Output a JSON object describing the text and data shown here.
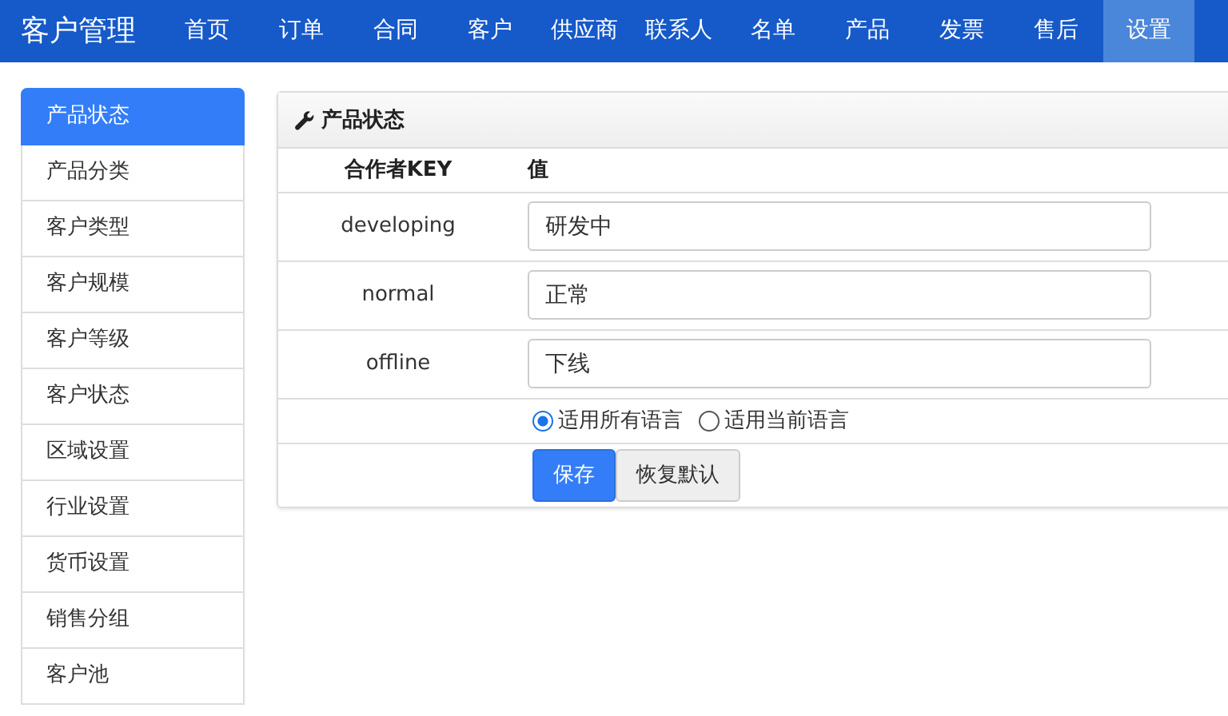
{
  "navbar": {
    "brand": "客户管理",
    "items": [
      {
        "label": "首页",
        "selected": false
      },
      {
        "label": "订单",
        "selected": false
      },
      {
        "label": "合同",
        "selected": false
      },
      {
        "label": "客户",
        "selected": false
      },
      {
        "label": "供应商",
        "selected": false
      },
      {
        "label": "联系人",
        "selected": false
      },
      {
        "label": "名单",
        "selected": false
      },
      {
        "label": "产品",
        "selected": false
      },
      {
        "label": "发票",
        "selected": false
      },
      {
        "label": "售后",
        "selected": false
      },
      {
        "label": "设置",
        "selected": true
      }
    ]
  },
  "sidebar": {
    "items": [
      {
        "label": "产品状态",
        "selected": true
      },
      {
        "label": "产品分类",
        "selected": false
      },
      {
        "label": "客户类型",
        "selected": false
      },
      {
        "label": "客户规模",
        "selected": false
      },
      {
        "label": "客户等级",
        "selected": false
      },
      {
        "label": "客户状态",
        "selected": false
      },
      {
        "label": "区域设置",
        "selected": false
      },
      {
        "label": "行业设置",
        "selected": false
      },
      {
        "label": "货币设置",
        "selected": false
      },
      {
        "label": "销售分组",
        "selected": false
      },
      {
        "label": "客户池",
        "selected": false
      }
    ]
  },
  "panel": {
    "title": "产品状态",
    "columns": [
      "合作者KEY",
      "值"
    ],
    "rows": [
      {
        "key": "developing",
        "value": "研发中"
      },
      {
        "key": "normal",
        "value": "正常"
      },
      {
        "key": "offline",
        "value": "下线"
      }
    ],
    "scope_options": [
      {
        "label": "适用所有语言",
        "selected": true
      },
      {
        "label": "适用当前语言",
        "selected": false
      }
    ],
    "buttons": [
      {
        "label": "保存",
        "kind": "primary"
      },
      {
        "label": "恢复默认",
        "kind": "default"
      }
    ]
  }
}
